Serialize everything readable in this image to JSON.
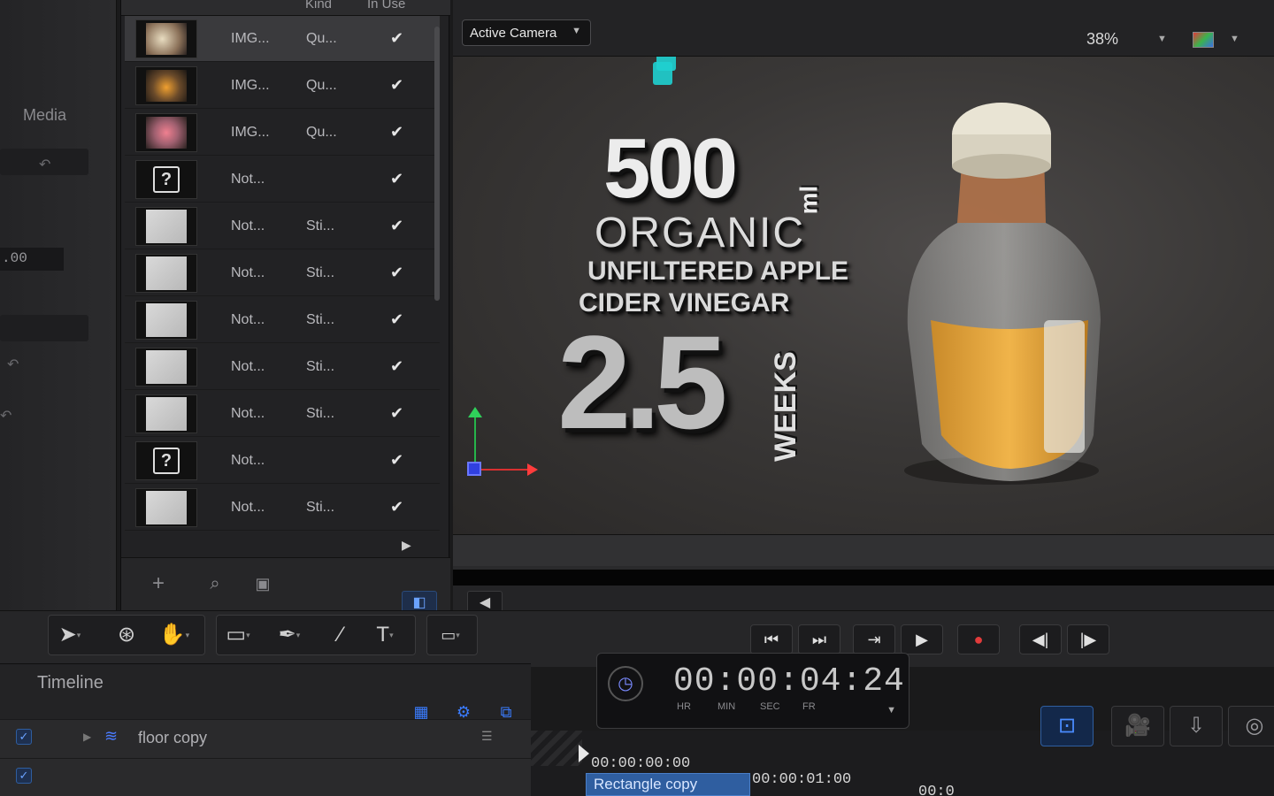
{
  "left_panel": {
    "media_label": "Media",
    "value_readout": ".00"
  },
  "library": {
    "columns": {
      "kind": "Kind",
      "in_use": "In Use"
    },
    "rows": [
      {
        "name": "IMG...",
        "kind": "Qu...",
        "in_use": "✔",
        "thumb": "photo-food",
        "selected": true
      },
      {
        "name": "IMG...",
        "kind": "Qu...",
        "in_use": "✔",
        "thumb": "photo-bottle"
      },
      {
        "name": "IMG...",
        "kind": "Qu...",
        "in_use": "✔",
        "thumb": "photo-flower"
      },
      {
        "name": "Not...",
        "kind": "",
        "in_use": "✔",
        "thumb": "missing"
      },
      {
        "name": "Not...",
        "kind": "Sti...",
        "in_use": "✔",
        "thumb": "white"
      },
      {
        "name": "Not...",
        "kind": "Sti...",
        "in_use": "✔",
        "thumb": "white"
      },
      {
        "name": "Not...",
        "kind": "Sti...",
        "in_use": "✔",
        "thumb": "white"
      },
      {
        "name": "Not...",
        "kind": "Sti...",
        "in_use": "✔",
        "thumb": "white"
      },
      {
        "name": "Not...",
        "kind": "Sti...",
        "in_use": "✔",
        "thumb": "white"
      },
      {
        "name": "Not...",
        "kind": "",
        "in_use": "✔",
        "thumb": "missing"
      },
      {
        "name": "Not...",
        "kind": "Sti...",
        "in_use": "✔",
        "thumb": "white"
      }
    ],
    "footer_tools": [
      "plus-icon",
      "search-icon",
      "import-icon"
    ]
  },
  "viewer": {
    "camera_select": "Active Camera",
    "zoom": "38%",
    "title_text": {
      "big_number": "500",
      "unit": "ml",
      "line_organic": "ORGANIC",
      "line_unfiltered": "UNFILTERED APPLE",
      "line_cider": "CIDER  VINEGAR",
      "duration": "2.5",
      "duration_unit": "WEEKS"
    },
    "transport": {
      "timecode": "00:00:04:24",
      "units": [
        "HR",
        "MIN",
        "SEC",
        "FR"
      ]
    }
  },
  "toolbar": {
    "tools": [
      "select-arrow-icon",
      "3d-transform-icon",
      "hand-icon",
      "rectangle-icon",
      "bezier-pen-icon",
      "paint-brush-icon",
      "text-icon",
      "mask-icon"
    ],
    "text_tool_label": "T"
  },
  "timeline": {
    "label": "Timeline",
    "layers": [
      {
        "name": "floor copy",
        "checked": true
      }
    ],
    "ruler": {
      "start": "00:00:00:00",
      "one_second": "00:00:01:00",
      "two_second": "00:0"
    },
    "clip_label": "Rectangle copy"
  },
  "colors": {
    "accent_blue": "#3a7cff",
    "record_red": "#e23b3b",
    "gizmo_green": "#2fd05a",
    "gizmo_red": "#ff3c3c",
    "gizmo_blue": "#3040e0",
    "camera_marker": "#1fd0d0"
  }
}
